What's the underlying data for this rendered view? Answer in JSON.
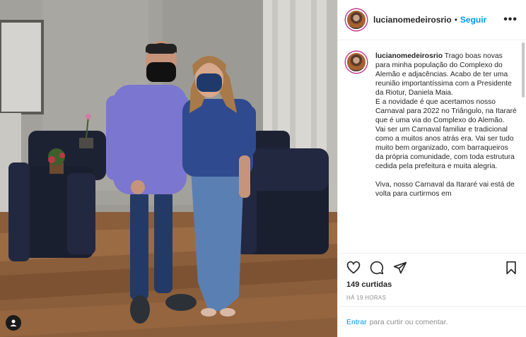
{
  "post": {
    "username": "lucianomedeirosrio",
    "separator": "•",
    "follow_label": "Seguir",
    "more_label": "•••",
    "caption_username": "lucianomedeirosrio",
    "caption_text": " Trago boas novas para minha população do Complexo do Alemão e adjacências. Acabo de ter uma reunião importantíssima com a Presidente da Riotur, Daniela Maia.\nE a novidade é que acertamos nosso Carnaval para 2022 no Triângulo, na Itararé que é uma via do Complexo do Alemão.\nVai ser um Carnaval familiar e tradicional como a muitos anos atrás era. Vai ser tudo muito bem organizado, com barraqueiros da própria comunidade, com toda estrutura cedida pela prefeitura e muita alegria.\n\nViva, nosso Carnaval da Itararé vai está de volta para curtirmos em",
    "likes": "149 curtidas",
    "time_ago": "HÁ 19 HORAS",
    "login_link": "Entrar",
    "login_rest": "para curtir ou comentar."
  },
  "icons": {
    "like": "heart-icon",
    "comment": "comment-icon",
    "share": "share-icon",
    "save": "bookmark-icon",
    "tag": "user-tag-icon"
  },
  "colors": {
    "link_blue": "#0095f6",
    "text": "#262626",
    "muted": "#8e8e8e",
    "border": "#efefef"
  }
}
